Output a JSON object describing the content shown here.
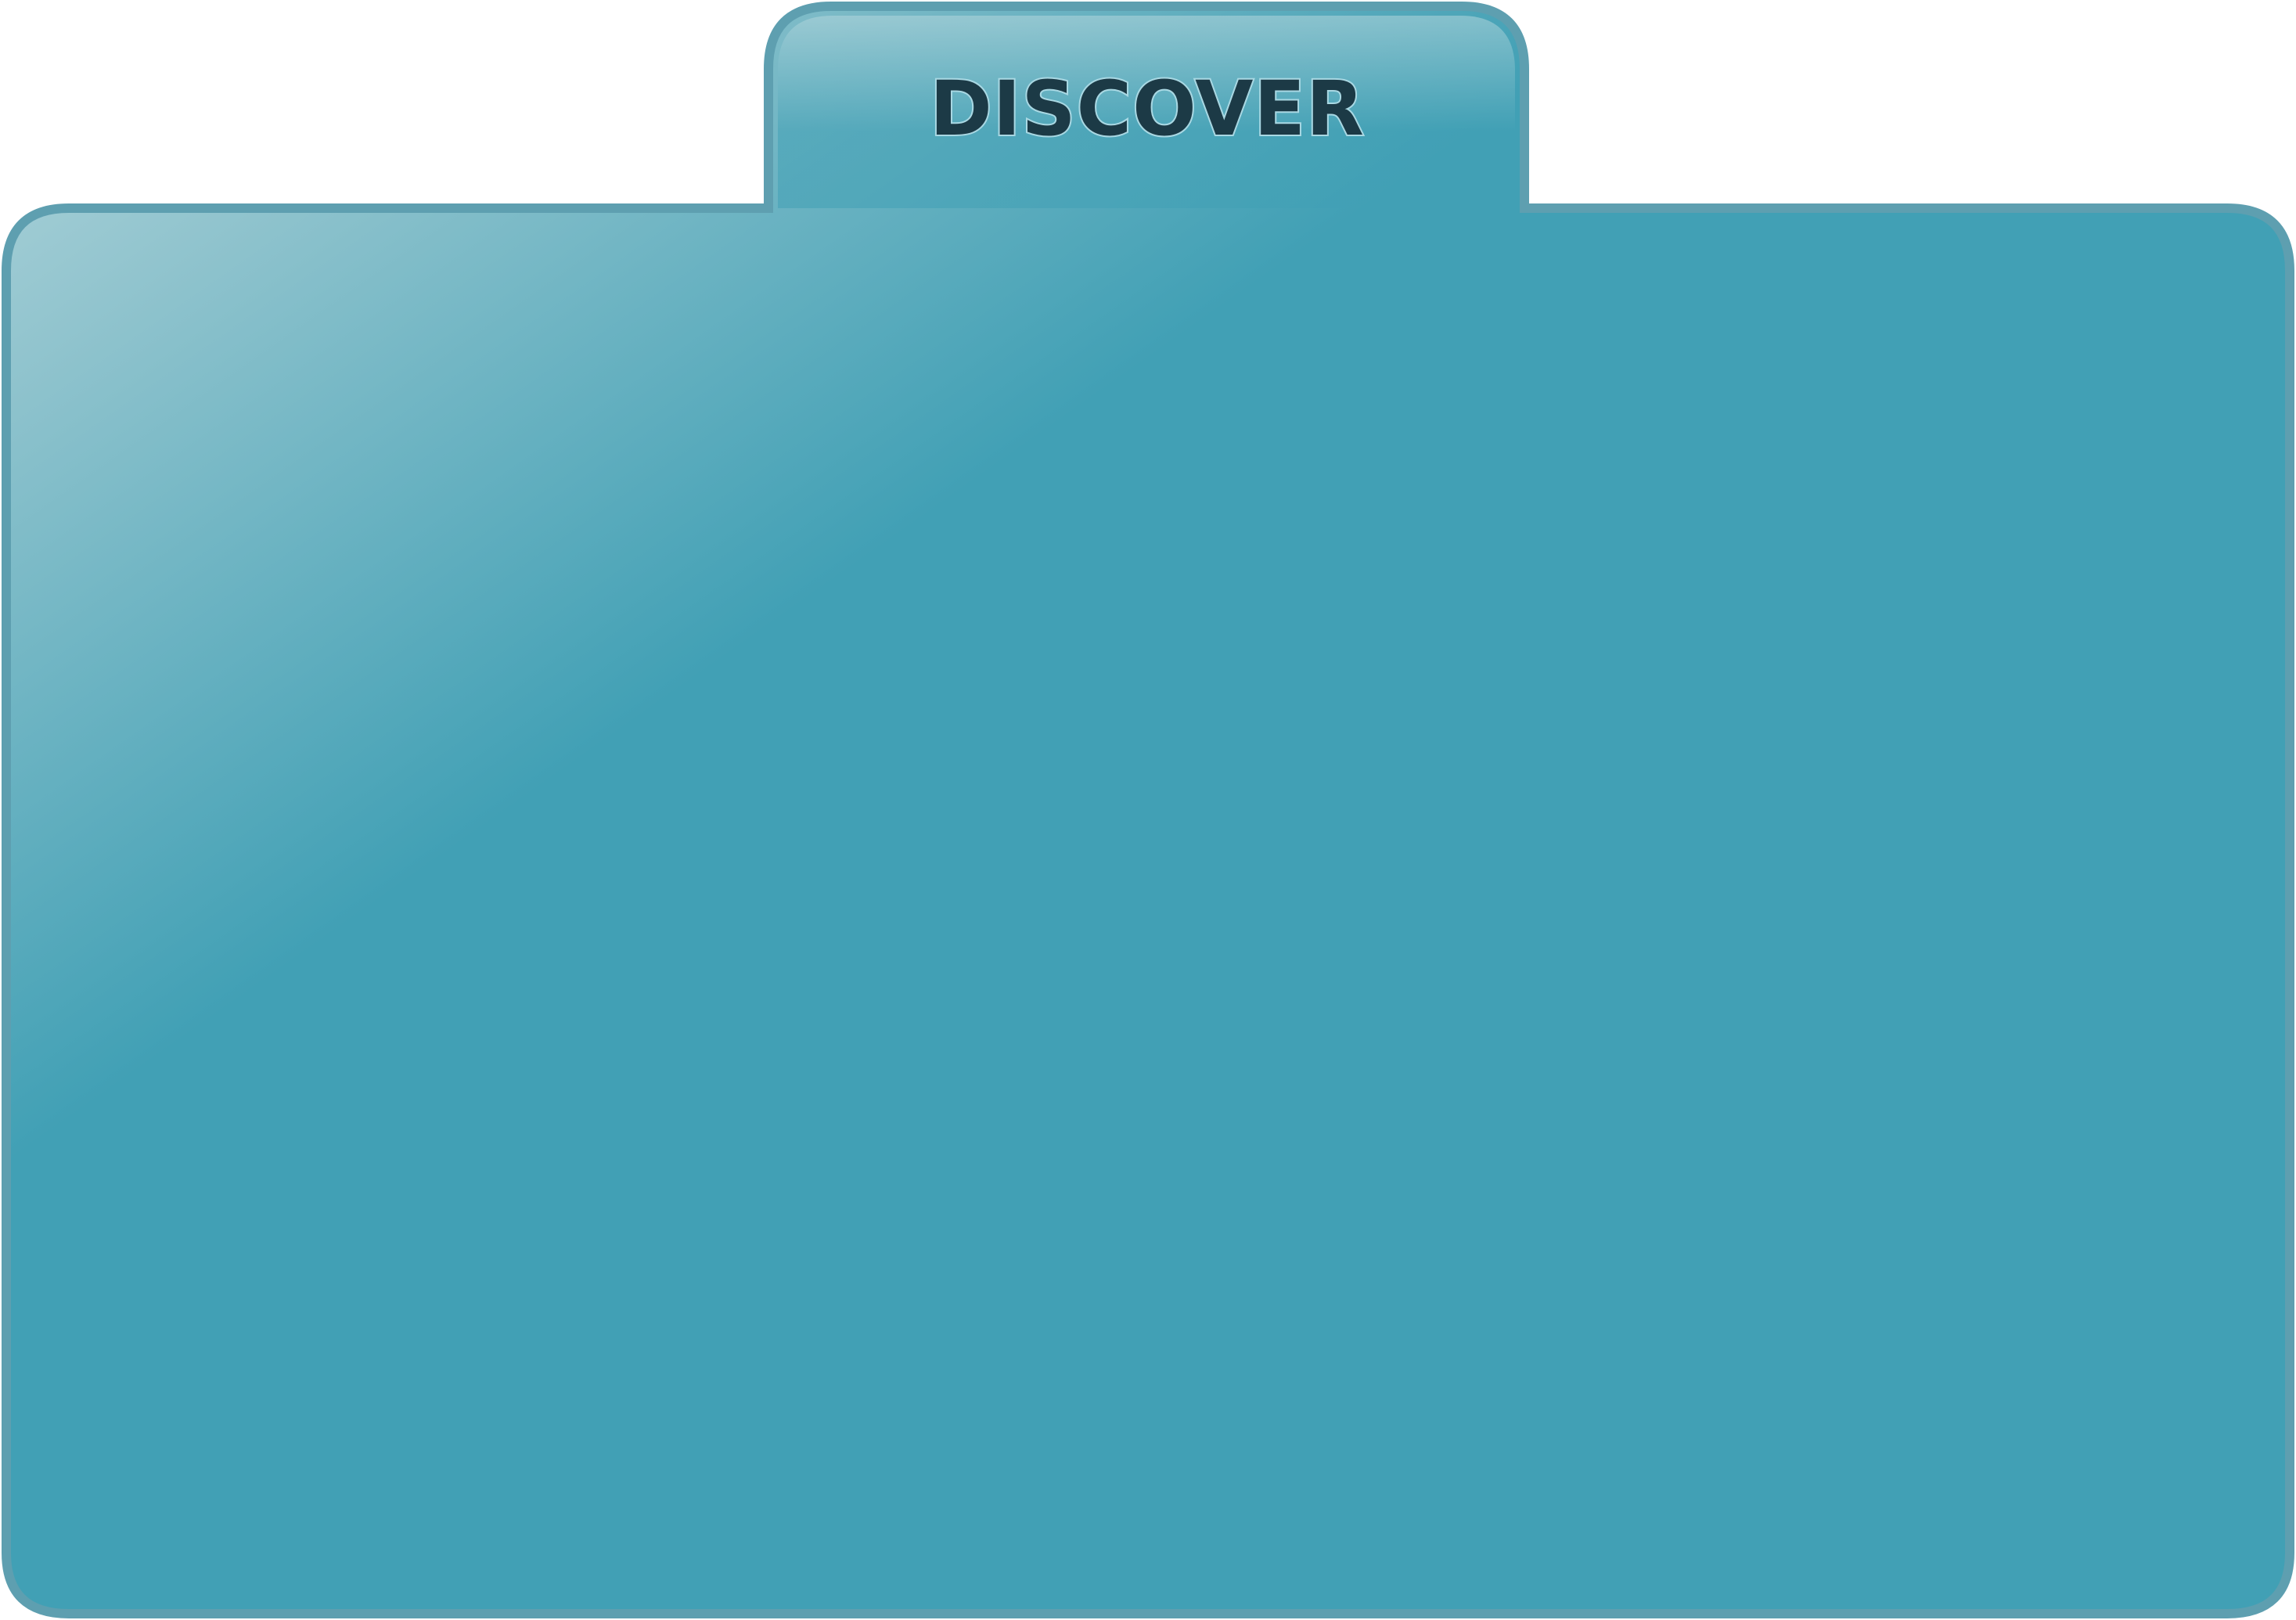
{
  "folder": {
    "tab_label": "DISCOVER",
    "colors": {
      "body_fill": "#41a0b5",
      "highlight": "#b3d6dc",
      "border": "#5e9fb0",
      "label_fill": "#1c3a46",
      "label_outline": "#a9d8e3"
    }
  }
}
